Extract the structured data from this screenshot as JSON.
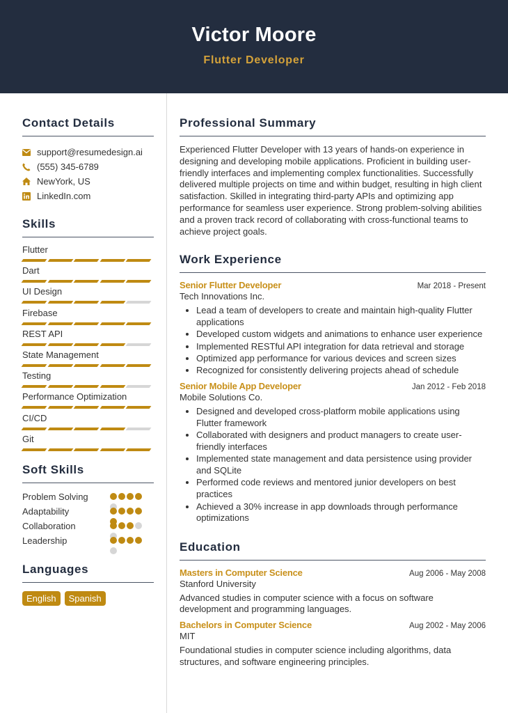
{
  "header": {
    "name": "Victor Moore",
    "title": "Flutter Developer"
  },
  "colors": {
    "header_bg": "#232d3f",
    "accent": "#bf8a12",
    "title_gold": "#d4a23a",
    "inactive": "#d6d6d6"
  },
  "contact": {
    "title": "Contact Details",
    "items": [
      {
        "icon": "envelope-icon",
        "text": "support@resumedesign.ai"
      },
      {
        "icon": "phone-icon",
        "text": "(555) 345-6789"
      },
      {
        "icon": "home-icon",
        "text": "NewYork, US"
      },
      {
        "icon": "linkedin-icon",
        "text": "LinkedIn.com"
      }
    ]
  },
  "skills": {
    "title": "Skills",
    "max": 5,
    "items": [
      {
        "label": "Flutter",
        "level": 5
      },
      {
        "label": "Dart",
        "level": 5
      },
      {
        "label": "UI Design",
        "level": 4
      },
      {
        "label": "Firebase",
        "level": 5
      },
      {
        "label": "REST API",
        "level": 4
      },
      {
        "label": "State Management",
        "level": 5
      },
      {
        "label": "Testing",
        "level": 4
      },
      {
        "label": "Performance Optimization",
        "level": 5
      },
      {
        "label": "CI/CD",
        "level": 4
      },
      {
        "label": "Git",
        "level": 5
      }
    ]
  },
  "soft_skills": {
    "title": "Soft Skills",
    "max": 5,
    "items": [
      {
        "label": "Problem Solving",
        "level": 4
      },
      {
        "label": "Adaptability",
        "level": 5
      },
      {
        "label": "Collaboration",
        "level": 3
      },
      {
        "label": "Leadership",
        "level": 4
      }
    ]
  },
  "languages": {
    "title": "Languages",
    "items": [
      "English",
      "Spanish"
    ]
  },
  "summary": {
    "title": "Professional Summary",
    "text": "Experienced Flutter Developer with 13 years of hands-on experience in designing and developing mobile applications. Proficient in building user-friendly interfaces and implementing complex functionalities. Successfully delivered multiple projects on time and within budget, resulting in high client satisfaction. Skilled in integrating third-party APIs and optimizing app performance for seamless user experience. Strong problem-solving abilities and a proven track record of collaborating with cross-functional teams to achieve project goals."
  },
  "experience": {
    "title": "Work Experience",
    "jobs": [
      {
        "title": "Senior Flutter Developer",
        "date": "Mar 2018 - Present",
        "org": "Tech Innovations Inc.",
        "bullets": [
          "Lead a team of developers to create and maintain high-quality Flutter applications",
          "Developed custom widgets and animations to enhance user experience",
          "Implemented RESTful API integration for data retrieval and storage",
          "Optimized app performance for various devices and screen sizes",
          "Recognized for consistently delivering projects ahead of schedule"
        ]
      },
      {
        "title": "Senior Mobile App Developer",
        "date": "Jan 2012 - Feb 2018",
        "org": "Mobile Solutions Co.",
        "bullets": [
          "Designed and developed cross-platform mobile applications using Flutter framework",
          "Collaborated with designers and product managers to create user-friendly interfaces",
          "Implemented state management and data persistence using provider and SQLite",
          "Performed code reviews and mentored junior developers on best practices",
          "Achieved a 30% increase in app downloads through performance optimizations"
        ]
      }
    ]
  },
  "education": {
    "title": "Education",
    "items": [
      {
        "degree": "Masters in Computer Science",
        "date": "Aug 2006 - May 2008",
        "school": "Stanford University",
        "desc": "Advanced studies in computer science with a focus on software development and programming languages."
      },
      {
        "degree": "Bachelors in Computer Science",
        "date": "Aug 2002 - May 2006",
        "school": "MIT",
        "desc": "Foundational studies in computer science including algorithms, data structures, and software engineering principles."
      }
    ]
  }
}
